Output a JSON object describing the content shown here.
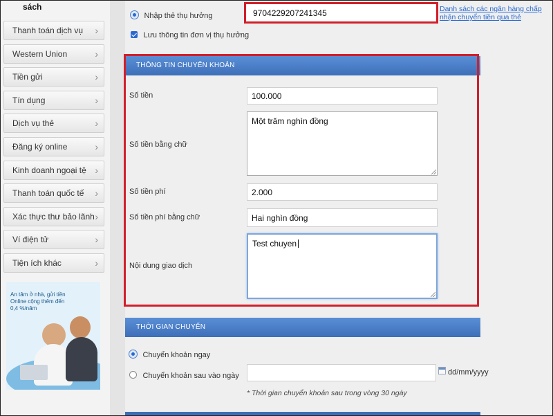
{
  "sidebar": {
    "top_label": "sách",
    "items": [
      {
        "label": "Thanh toán dịch vụ"
      },
      {
        "label": "Western Union"
      },
      {
        "label": "Tiền gửi"
      },
      {
        "label": "Tín dụng"
      },
      {
        "label": "Dịch vụ thẻ"
      },
      {
        "label": "Đăng ký online"
      },
      {
        "label": "Kinh doanh ngoại tệ"
      },
      {
        "label": "Thanh toán quốc tế"
      },
      {
        "label": "Xác thực thư bảo lãnh"
      },
      {
        "label": "Ví điện tử"
      },
      {
        "label": "Tiện ích khác"
      }
    ],
    "banner_text": "An tâm ở nhà, gửi tiền Online cộng thêm đến 0,4 %/năm"
  },
  "recipient": {
    "radio_label": "Nhập thẻ thụ hưởng",
    "card_number": "9704229207241345",
    "bank_list_link": "Danh sách các ngân hàng chấp nhận chuyển tiền qua thẻ",
    "save_label": "Lưu thông tin đơn vị thụ hưởng"
  },
  "transfer_info": {
    "header": "THÔNG TIN CHUYỂN KHOẢN",
    "amount_label": "Số tiền",
    "amount_value": "100.000",
    "amount_words_label": "Số tiền bằng chữ",
    "amount_words_value": "Một trăm nghìn đồng",
    "fee_label": "Số tiền phí",
    "fee_value": "2.000",
    "fee_words_label": "Số tiền phí bằng chữ",
    "fee_words_value": "Hai nghìn đồng",
    "content_label": "Nội dung giao dịch",
    "content_value": "Test chuyen"
  },
  "transfer_time": {
    "header": "THỜI GIAN CHUYỂN",
    "now_label": "Chuyển khoản ngay",
    "later_label": "Chuyển khoản sau vào ngày",
    "date_placeholder": "dd/mm/yyyy",
    "note": "* Thời gian chuyển khoản sau trong vòng 30 ngày"
  },
  "colors": {
    "accent": "#3d6fb9",
    "highlight": "#d11f2a"
  }
}
